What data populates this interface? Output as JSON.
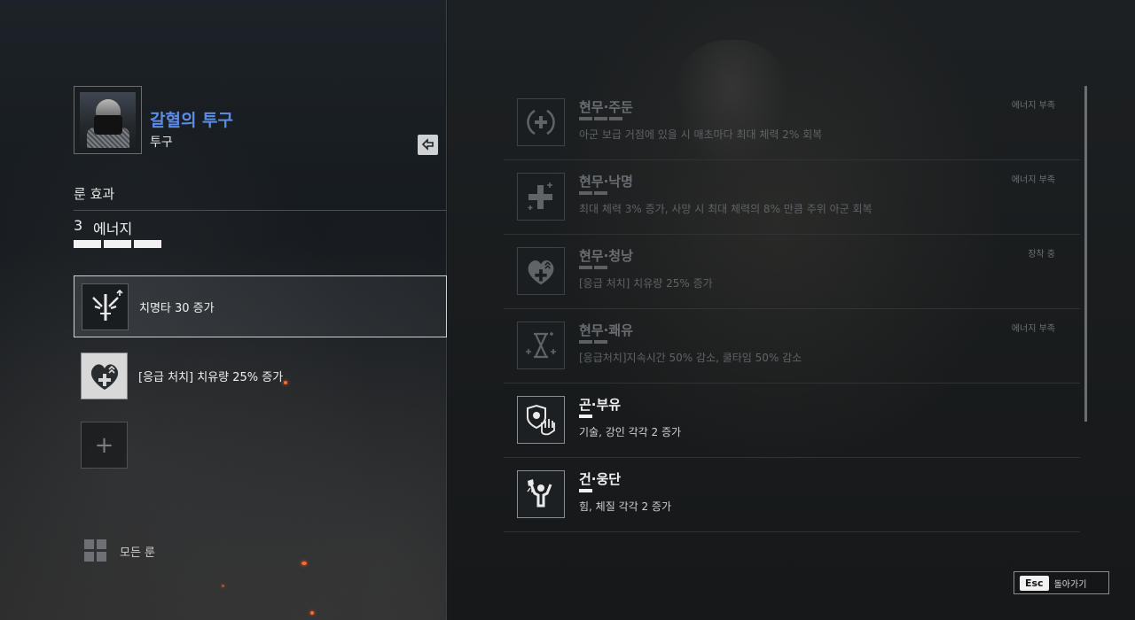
{
  "item": {
    "name": "갈혈의 투구",
    "type": "투구"
  },
  "rune_effects": {
    "title": "룬 효과",
    "energy_count": "3",
    "energy_label": "에너지",
    "energy_max": 3,
    "energy_filled": 3
  },
  "equipped_slots": [
    {
      "label": "치명타 30 증가",
      "icon": "crit-sword-icon",
      "selected": true
    },
    {
      "label": "[응급 처치] 치유량 25% 증가",
      "icon": "heart-heal-icon",
      "selected": false
    }
  ],
  "all_runes_label": "모든 룬",
  "rune_list": [
    {
      "name": "현무·주둔",
      "desc": "아군 보급 거점에 있을 시 매초마다 최대 체력 2% 회복",
      "status": "에너지 부족",
      "bars": 3,
      "icon": "circle-plus-icon",
      "active": false
    },
    {
      "name": "현무·낙명",
      "desc": "최대 체력 3% 증가, 사망 시 최대 체력의 8% 만큼 주위 아군 회복",
      "status": "에너지 부족",
      "bars": 2,
      "icon": "cross-plus-icon",
      "active": false
    },
    {
      "name": "현무·청낭",
      "desc": "[응급 처치] 치유량 25% 증가",
      "status": "장착 중",
      "bars": 2,
      "icon": "heart-heal-icon",
      "active": false
    },
    {
      "name": "현무·쾌유",
      "desc": "[응급처치]지속시간 50% 감소, 쿨타임 50% 감소",
      "status": "에너지 부족",
      "bars": 2,
      "icon": "hourglass-plus-icon",
      "active": false
    },
    {
      "name": "곤·부유",
      "desc": "기술, 강인 각각 2 증가",
      "status": "",
      "bars": 1,
      "icon": "shield-hand-icon",
      "active": true
    },
    {
      "name": "건·웅단",
      "desc": "힘, 체질 각각 2 증가",
      "status": "",
      "bars": 1,
      "icon": "strong-man-icon",
      "active": true
    }
  ],
  "esc": {
    "key": "Esc",
    "label": "돌아가기"
  }
}
